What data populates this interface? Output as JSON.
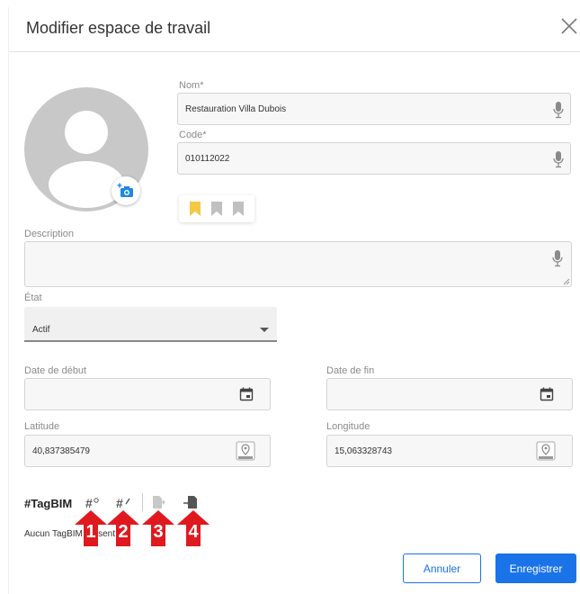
{
  "dialog": {
    "title": "Modifier espace de travail"
  },
  "form": {
    "nom": {
      "label": "Nom*",
      "value": "Restauration Villa Dubois"
    },
    "code": {
      "label": "Code*",
      "value": "010112022"
    },
    "description": {
      "label": "Description",
      "value": ""
    },
    "etat": {
      "label": "État",
      "value": "Actif"
    },
    "date_debut": {
      "label": "Date de début",
      "value": ""
    },
    "date_fin": {
      "label": "Date de fin",
      "value": ""
    },
    "latitude": {
      "label": "Latitude",
      "value": "40,837385479"
    },
    "longitude": {
      "label": "Longitude",
      "value": "15,063328743"
    }
  },
  "bookmarks": {
    "active_count": 1,
    "total": 3,
    "active_color": "#f5c842",
    "inactive_color": "#c0c0c0"
  },
  "tagbim": {
    "title": "#TagBIM",
    "empty_text": "Aucun TagBIM présent",
    "tools": [
      "tag-link-icon",
      "tag-edit-icon",
      "export-icon",
      "import-icon"
    ]
  },
  "annotations": [
    "1",
    "2",
    "3",
    "4"
  ],
  "buttons": {
    "cancel": "Annuler",
    "save": "Enregistrer"
  },
  "colors": {
    "primary": "#1a73e8",
    "annotation": "#e0191f",
    "avatar": "#c8c8c8"
  }
}
